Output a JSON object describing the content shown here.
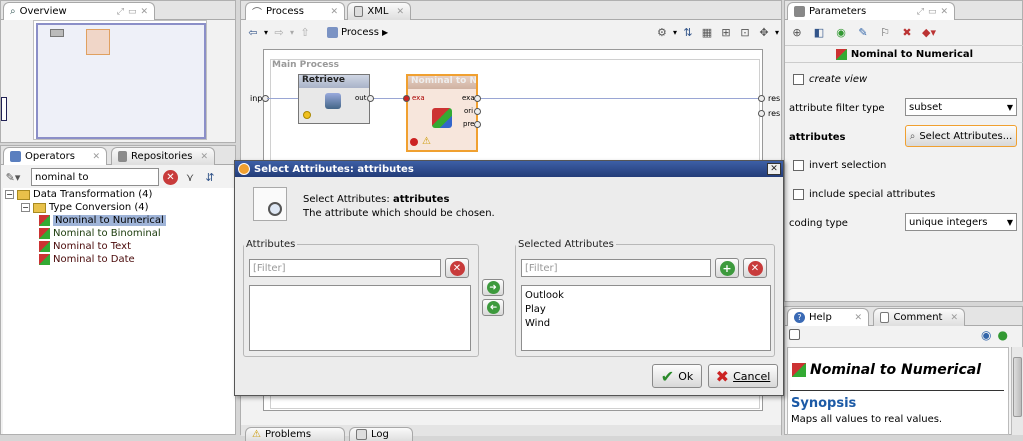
{
  "left_top": {
    "tab_label": "Overview"
  },
  "left_bottom": {
    "tabs": [
      {
        "label": "Operators"
      },
      {
        "label": "Repositories"
      }
    ],
    "search_value": "nominal to",
    "tree": {
      "root": "Data Transformation (4)",
      "group": "Type Conversion (4)",
      "items": [
        {
          "label": "Nominal to Numerical",
          "selected": true
        },
        {
          "label": "Nominal to Binominal",
          "selected": false
        },
        {
          "label": "Nominal to Text",
          "selected": false
        },
        {
          "label": "Nominal to Date",
          "selected": false
        }
      ]
    }
  },
  "center": {
    "tabs": [
      {
        "label": "Process"
      },
      {
        "label": "XML"
      }
    ],
    "breadcrumb": "Process",
    "canvas_title": "Main Process",
    "left_port": "inp",
    "right_ports": [
      "res",
      "res"
    ],
    "operators": [
      {
        "name": "Retrieve",
        "ports_out": [
          "out"
        ]
      },
      {
        "name": "Nominal to Nu...",
        "ports_in": [
          "exa"
        ],
        "ports_out": [
          "exa",
          "ori",
          "pre"
        ]
      }
    ],
    "bottom_tabs": [
      {
        "label": "Problems"
      },
      {
        "label": "Log"
      }
    ]
  },
  "right_top": {
    "tab_label": "Parameters",
    "operator_title": "Nominal to Numerical",
    "create_view": "create view",
    "attribute_filter_type_label": "attribute filter type",
    "attribute_filter_type_value": "subset",
    "attributes_label": "attributes",
    "select_attributes_button": "Select Attributes...",
    "invert_selection": "invert selection",
    "include_special": "include special attributes",
    "coding_type_label": "coding type",
    "coding_type_value": "unique integers"
  },
  "right_bottom": {
    "tabs": [
      {
        "label": "Help"
      },
      {
        "label": "Comment"
      }
    ],
    "title": "Nominal to Numerical",
    "synopsis_heading": "Synopsis",
    "synopsis_text": "Maps all values to real values."
  },
  "dialog": {
    "title": "Select Attributes: attributes",
    "heading_prefix": "Select Attributes: ",
    "heading_bold": "attributes",
    "description": "The attribute which should be chosen.",
    "attributes_legend": "Attributes",
    "selected_legend": "Selected Attributes",
    "filter_placeholder": "[Filter]",
    "selected_items": [
      "Outlook",
      "Play",
      "Wind"
    ],
    "ok_label": "Ok",
    "cancel_label": "Cancel"
  },
  "colors": {
    "accent_blue": "#233c78",
    "selection": "#9fb4d8",
    "operator_highlight": "#f0a030",
    "help_link": "#1c5aa6"
  }
}
